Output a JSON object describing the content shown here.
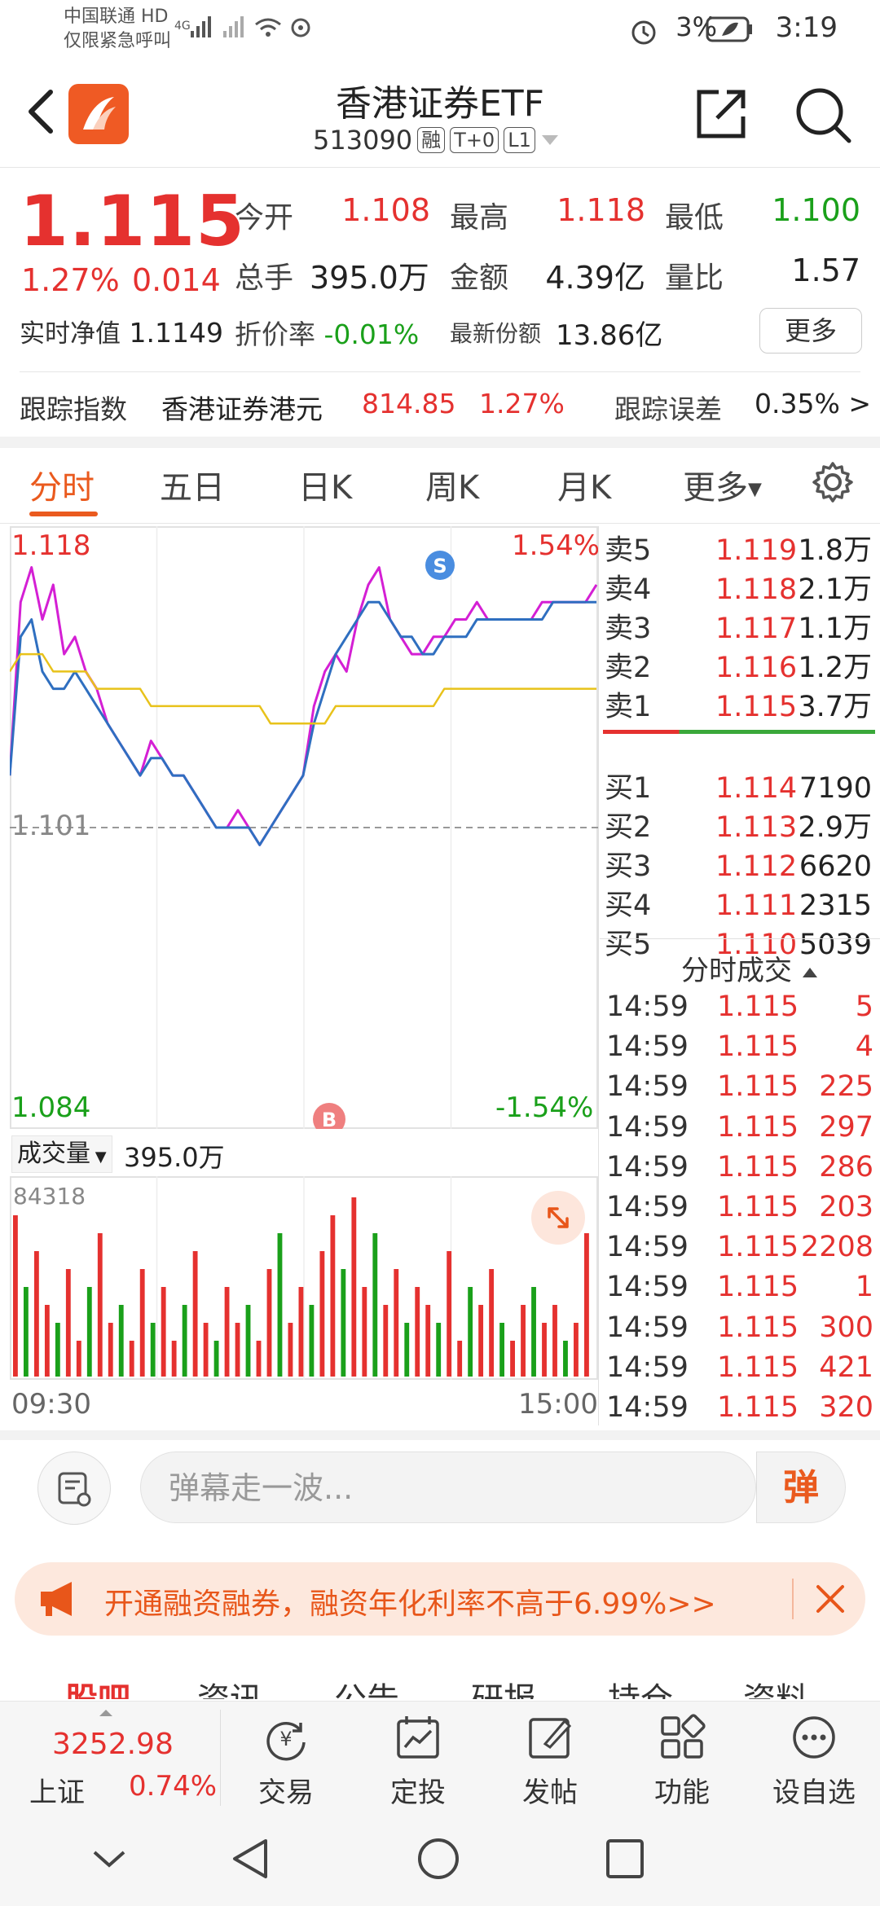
{
  "status_bar": {
    "carrier_line1": "中国联通 HD",
    "carrier_line2": "仅限紧急呼叫",
    "battery": "3%",
    "time": "3:19"
  },
  "header": {
    "title": "香港证券ETF",
    "code": "513090",
    "tags": [
      "融",
      "T+0",
      "L1"
    ]
  },
  "quote": {
    "price": "1.115",
    "change_pct": "1.27%",
    "change": "0.014",
    "open_label": "今开",
    "open": "1.108",
    "high_label": "最高",
    "high": "1.118",
    "low_label": "最低",
    "low": "1.100",
    "volume_label": "总手",
    "volume": "395.0万",
    "amount_label": "金额",
    "amount": "4.39亿",
    "ratio_label": "量比",
    "ratio": "1.57",
    "nav_label": "实时净值",
    "nav": "1.1149",
    "discount_label": "折价率",
    "discount": "-0.01%",
    "shares_label": "最新份额",
    "shares": "13.86亿",
    "more_button": "更多"
  },
  "tracking": {
    "index_label": "跟踪指数",
    "index_name": "香港证券港元",
    "index_value": "814.85",
    "index_pct": "1.27%",
    "error_label": "跟踪误差",
    "error_value": "0.35% >"
  },
  "tabs": [
    "分时",
    "五日",
    "日K",
    "周K",
    "月K",
    "更多"
  ],
  "chart_labels": {
    "top_price": "1.118",
    "top_pct": "1.54%",
    "mid_price": "1.101",
    "bottom_price": "1.084",
    "bottom_pct": "-1.54%",
    "volume_selector": "成交量",
    "volume_total": "395.0万",
    "volume_max": "84318",
    "time_start": "09:30",
    "time_end": "15:00",
    "sell_marker": "S",
    "buy_marker": "B"
  },
  "chart_data": {
    "type": "line",
    "ylim": [
      1.084,
      1.118
    ],
    "series": [
      {
        "values": [
          1.104,
          1.114,
          1.116,
          1.113,
          1.115,
          1.111,
          1.112,
          1.11,
          1.109,
          1.107,
          1.106,
          1.105,
          1.104,
          1.106,
          1.105,
          1.104,
          1.104,
          1.103,
          1.102,
          1.101,
          1.101,
          1.102,
          1.101,
          1.1,
          1.101,
          1.102,
          1.103,
          1.104,
          1.108,
          1.11,
          1.111,
          1.11,
          1.113,
          1.115,
          1.116,
          1.113,
          1.112,
          1.111,
          1.111,
          1.112,
          1.112,
          1.113,
          1.113,
          1.114,
          1.113,
          1.113,
          1.113,
          1.113,
          1.113,
          1.114,
          1.114,
          1.114,
          1.114,
          1.114,
          1.115
        ]
      },
      {
        "values": [
          1.104,
          1.112,
          1.113,
          1.11,
          1.109,
          1.109,
          1.11,
          1.109,
          1.108,
          1.107,
          1.106,
          1.105,
          1.104,
          1.105,
          1.105,
          1.104,
          1.104,
          1.103,
          1.102,
          1.101,
          1.101,
          1.101,
          1.101,
          1.1,
          1.101,
          1.102,
          1.103,
          1.104,
          1.107,
          1.109,
          1.111,
          1.112,
          1.113,
          1.114,
          1.114,
          1.113,
          1.112,
          1.112,
          1.111,
          1.111,
          1.112,
          1.112,
          1.112,
          1.113,
          1.113,
          1.113,
          1.113,
          1.113,
          1.113,
          1.113,
          1.114,
          1.114,
          1.114,
          1.114,
          1.114
        ]
      },
      {
        "values": [
          1.11,
          1.111,
          1.111,
          1.111,
          1.11,
          1.11,
          1.11,
          1.11,
          1.109,
          1.109,
          1.109,
          1.109,
          1.109,
          1.108,
          1.108,
          1.108,
          1.108,
          1.108,
          1.108,
          1.108,
          1.108,
          1.108,
          1.108,
          1.108,
          1.107,
          1.107,
          1.107,
          1.107,
          1.107,
          1.107,
          1.108,
          1.108,
          1.108,
          1.108,
          1.108,
          1.108,
          1.108,
          1.108,
          1.108,
          1.108,
          1.109,
          1.109,
          1.109,
          1.109,
          1.109,
          1.109,
          1.109,
          1.109,
          1.109,
          1.109,
          1.109,
          1.109,
          1.109,
          1.109,
          1.109
        ]
      }
    ],
    "volume": [
      9,
      5,
      7,
      4,
      3,
      6,
      2,
      5,
      8,
      3,
      4,
      2,
      6,
      3,
      5,
      2,
      4,
      7,
      3,
      2,
      5,
      3,
      4,
      2,
      6,
      8,
      3,
      5,
      4,
      7,
      9,
      6,
      10,
      5,
      8,
      4,
      6,
      3,
      5,
      4,
      3,
      7,
      2,
      5,
      4,
      6,
      3,
      2,
      4,
      5,
      3,
      4,
      2,
      3,
      8
    ],
    "volume_max": 84318
  },
  "order_book": {
    "asks": [
      {
        "label": "卖5",
        "price": "1.119",
        "vol": "1.8万"
      },
      {
        "label": "卖4",
        "price": "1.118",
        "vol": "2.1万"
      },
      {
        "label": "卖3",
        "price": "1.117",
        "vol": "1.1万"
      },
      {
        "label": "卖2",
        "price": "1.116",
        "vol": "1.2万"
      },
      {
        "label": "卖1",
        "price": "1.115",
        "vol": "3.7万"
      }
    ],
    "bids": [
      {
        "label": "买1",
        "price": "1.114",
        "vol": "7190"
      },
      {
        "label": "买2",
        "price": "1.113",
        "vol": "2.9万"
      },
      {
        "label": "买3",
        "price": "1.112",
        "vol": "6620"
      },
      {
        "label": "买4",
        "price": "1.111",
        "vol": "2315"
      },
      {
        "label": "买5",
        "price": "1.110",
        "vol": "5039"
      }
    ]
  },
  "trades": {
    "header": "分时成交",
    "rows": [
      {
        "time": "14:59",
        "price": "1.115",
        "vol": "5"
      },
      {
        "time": "14:59",
        "price": "1.115",
        "vol": "4"
      },
      {
        "time": "14:59",
        "price": "1.115",
        "vol": "225"
      },
      {
        "time": "14:59",
        "price": "1.115",
        "vol": "297"
      },
      {
        "time": "14:59",
        "price": "1.115",
        "vol": "286"
      },
      {
        "time": "14:59",
        "price": "1.115",
        "vol": "203"
      },
      {
        "time": "14:59",
        "price": "1.115",
        "vol": "2208"
      },
      {
        "time": "14:59",
        "price": "1.115",
        "vol": "1"
      },
      {
        "time": "14:59",
        "price": "1.115",
        "vol": "300"
      },
      {
        "time": "14:59",
        "price": "1.115",
        "vol": "421"
      },
      {
        "time": "14:59",
        "price": "1.115",
        "vol": "320"
      }
    ]
  },
  "barrage": {
    "placeholder": "弹幕走一波...",
    "button": "弹"
  },
  "promo": {
    "text": "开通融资融券，融资年化利率不高于6.99%>>"
  },
  "subtabs": [
    "股吧",
    "资讯",
    "公告",
    "研报",
    "持仓",
    "资料"
  ],
  "toolbar": {
    "index_value": "3252.98",
    "index_name": "上证",
    "index_pct": "0.74%",
    "items": [
      "交易",
      "定投",
      "发帖",
      "功能",
      "设自选"
    ]
  }
}
